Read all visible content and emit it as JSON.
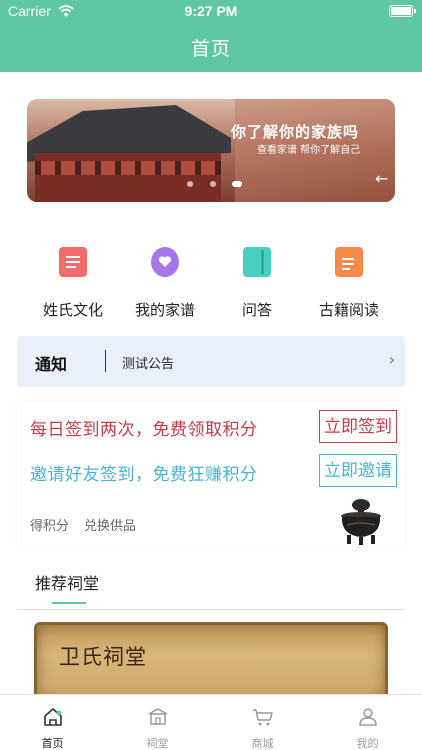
{
  "status_bar": {
    "carrier": "Carrier",
    "time": "9:27 PM"
  },
  "header": {
    "title": "首页"
  },
  "banner": {
    "title": "你了解你的家族吗",
    "subtitle": "查看家谱 帮你了解自己",
    "dot_count": 3,
    "active_dot": 2
  },
  "quick_menu": [
    {
      "label": "姓氏文化",
      "icon": "document-icon",
      "color": "#f36b6b"
    },
    {
      "label": "我的家谱",
      "icon": "heart-chat-icon",
      "color": "#a777e8"
    },
    {
      "label": "问答",
      "icon": "book-icon",
      "color": "#49cfc0"
    },
    {
      "label": "古籍阅读",
      "icon": "ancient-book-icon",
      "color": "#f5894a"
    }
  ],
  "notice": {
    "title": "通知",
    "text": "测试公告"
  },
  "checkin": {
    "daily_text": "每日签到两次，免费领取积分",
    "daily_button": "立即签到",
    "invite_text": "邀请好友签到，免费狂赚积分",
    "invite_button": "立即邀请",
    "earn_points": "得积分",
    "exchange": "兑换供品",
    "colors": {
      "daily": "#c93a47",
      "invite": "#49b3d3"
    }
  },
  "recommend": {
    "title": "推荐祠堂",
    "temple_name": "卫氏祠堂"
  },
  "tabbar": [
    {
      "label": "首页",
      "icon": "home-icon",
      "active": true
    },
    {
      "label": "祠堂",
      "icon": "shrine-icon",
      "active": false
    },
    {
      "label": "商城",
      "icon": "cart-icon",
      "active": false
    },
    {
      "label": "我的",
      "icon": "user-icon",
      "active": false
    }
  ],
  "accent_color": "#5fc8a2"
}
